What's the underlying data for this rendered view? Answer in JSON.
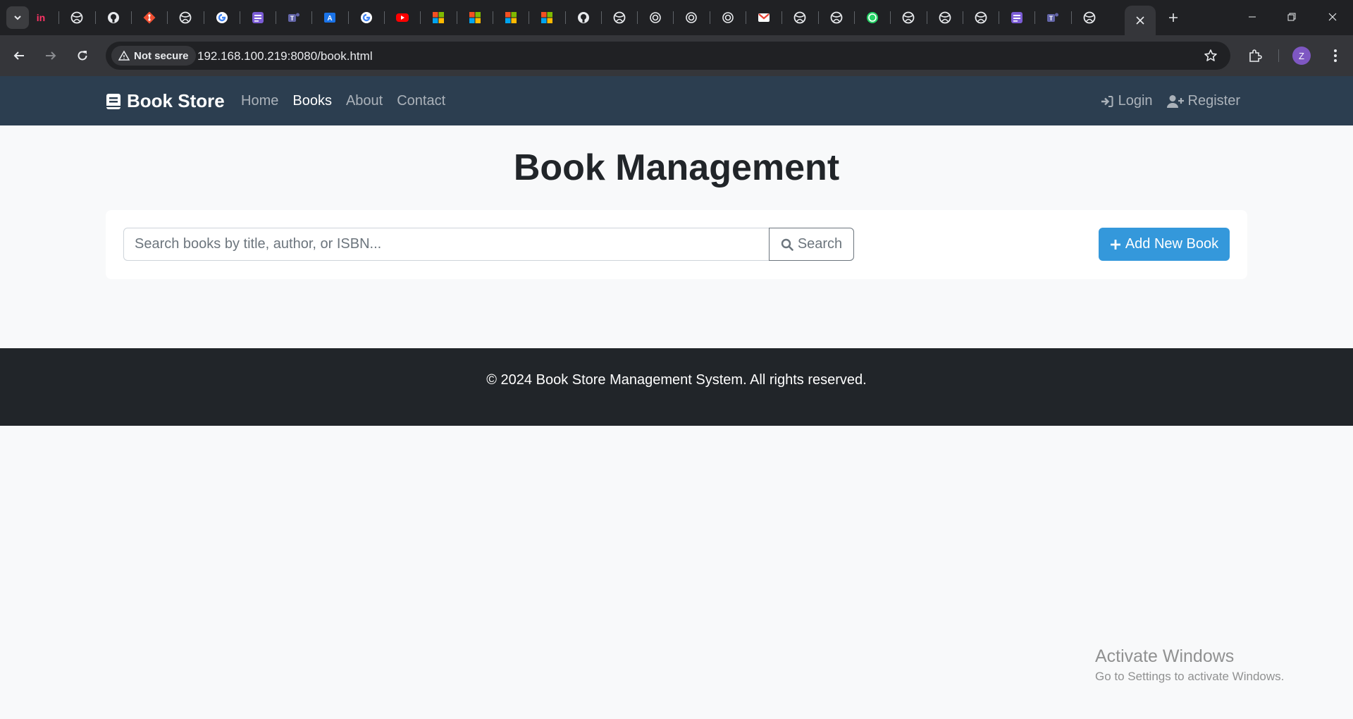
{
  "browser": {
    "tabs": [
      {
        "icon": "invision-icon",
        "color": "#ff3366"
      },
      {
        "icon": "globe-icon",
        "color": "#e8eaed"
      },
      {
        "icon": "github-icon",
        "color": "#e8eaed"
      },
      {
        "icon": "git-icon",
        "color": "#f05033"
      },
      {
        "icon": "globe-icon",
        "color": "#e8eaed"
      },
      {
        "icon": "google-icon",
        "color": "#4285f4"
      },
      {
        "icon": "forms-icon",
        "color": "#7b5cd6"
      },
      {
        "icon": "teams-icon",
        "color": "#6264a7"
      },
      {
        "icon": "translator-icon",
        "color": "#1a73e8"
      },
      {
        "icon": "google-icon",
        "color": "#4285f4"
      },
      {
        "icon": "youtube-icon",
        "color": "#ff0000"
      },
      {
        "icon": "microsoft-icon",
        "color": "#f25022"
      },
      {
        "icon": "microsoft-icon",
        "color": "#f25022"
      },
      {
        "icon": "microsoft-icon",
        "color": "#f25022"
      },
      {
        "icon": "microsoft-icon",
        "color": "#f25022"
      },
      {
        "icon": "github-icon",
        "color": "#e8eaed"
      },
      {
        "icon": "globe-icon",
        "color": "#e8eaed"
      },
      {
        "icon": "openai-icon",
        "color": "#e8eaed"
      },
      {
        "icon": "openai-icon",
        "color": "#e8eaed"
      },
      {
        "icon": "openai-icon",
        "color": "#e8eaed"
      },
      {
        "icon": "gmail-icon",
        "color": "#ea4335"
      },
      {
        "icon": "globe-icon",
        "color": "#e8eaed"
      },
      {
        "icon": "globe-icon",
        "color": "#e8eaed"
      },
      {
        "icon": "whatsapp-icon",
        "color": "#25d366"
      },
      {
        "icon": "globe-icon",
        "color": "#e8eaed"
      },
      {
        "icon": "globe-icon",
        "color": "#e8eaed"
      },
      {
        "icon": "globe-icon",
        "color": "#e8eaed"
      },
      {
        "icon": "forms-icon",
        "color": "#7b5cd6"
      },
      {
        "icon": "teams-icon",
        "color": "#6264a7"
      },
      {
        "icon": "globe-icon",
        "color": "#e8eaed"
      }
    ],
    "security_label": "Not secure",
    "url": "192.168.100.219:8080/book.html",
    "profile_initial": "Z"
  },
  "nav": {
    "brand": "Book Store",
    "links": [
      "Home",
      "Books",
      "About",
      "Contact"
    ],
    "active_link": "Books",
    "login": "Login",
    "register": "Register"
  },
  "page": {
    "title": "Book Management",
    "search_placeholder": "Search books by title, author, or ISBN...",
    "search_button": "Search",
    "add_button": "Add New Book"
  },
  "footer": {
    "text": "© 2024 Book Store Management System. All rights reserved."
  },
  "watermark": {
    "title": "Activate Windows",
    "subtitle": "Go to Settings to activate Windows."
  },
  "colors": {
    "navbar": "#2c3e50",
    "primary_button": "#3498db",
    "footer": "#212529"
  }
}
